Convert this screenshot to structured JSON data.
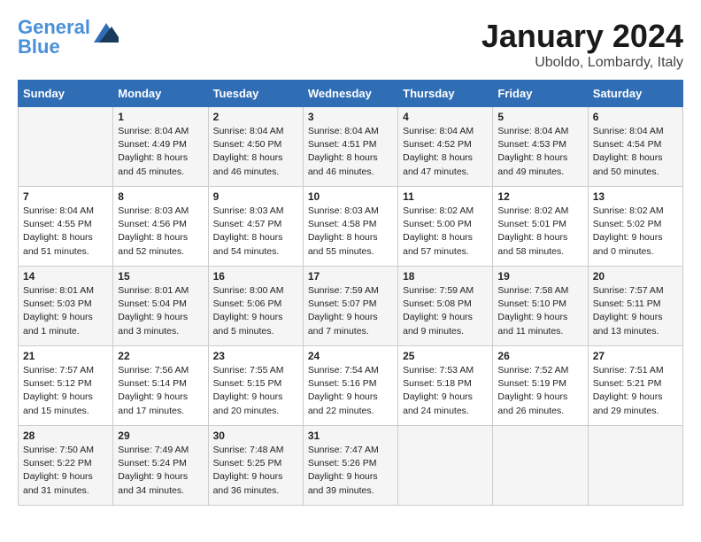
{
  "header": {
    "logo_line1": "General",
    "logo_line2": "Blue",
    "month": "January 2024",
    "location": "Uboldo, Lombardy, Italy"
  },
  "weekdays": [
    "Sunday",
    "Monday",
    "Tuesday",
    "Wednesday",
    "Thursday",
    "Friday",
    "Saturday"
  ],
  "weeks": [
    [
      {
        "day": "",
        "info": ""
      },
      {
        "day": "1",
        "info": "Sunrise: 8:04 AM\nSunset: 4:49 PM\nDaylight: 8 hours\nand 45 minutes."
      },
      {
        "day": "2",
        "info": "Sunrise: 8:04 AM\nSunset: 4:50 PM\nDaylight: 8 hours\nand 46 minutes."
      },
      {
        "day": "3",
        "info": "Sunrise: 8:04 AM\nSunset: 4:51 PM\nDaylight: 8 hours\nand 46 minutes."
      },
      {
        "day": "4",
        "info": "Sunrise: 8:04 AM\nSunset: 4:52 PM\nDaylight: 8 hours\nand 47 minutes."
      },
      {
        "day": "5",
        "info": "Sunrise: 8:04 AM\nSunset: 4:53 PM\nDaylight: 8 hours\nand 49 minutes."
      },
      {
        "day": "6",
        "info": "Sunrise: 8:04 AM\nSunset: 4:54 PM\nDaylight: 8 hours\nand 50 minutes."
      }
    ],
    [
      {
        "day": "7",
        "info": "Sunrise: 8:04 AM\nSunset: 4:55 PM\nDaylight: 8 hours\nand 51 minutes."
      },
      {
        "day": "8",
        "info": "Sunrise: 8:03 AM\nSunset: 4:56 PM\nDaylight: 8 hours\nand 52 minutes."
      },
      {
        "day": "9",
        "info": "Sunrise: 8:03 AM\nSunset: 4:57 PM\nDaylight: 8 hours\nand 54 minutes."
      },
      {
        "day": "10",
        "info": "Sunrise: 8:03 AM\nSunset: 4:58 PM\nDaylight: 8 hours\nand 55 minutes."
      },
      {
        "day": "11",
        "info": "Sunrise: 8:02 AM\nSunset: 5:00 PM\nDaylight: 8 hours\nand 57 minutes."
      },
      {
        "day": "12",
        "info": "Sunrise: 8:02 AM\nSunset: 5:01 PM\nDaylight: 8 hours\nand 58 minutes."
      },
      {
        "day": "13",
        "info": "Sunrise: 8:02 AM\nSunset: 5:02 PM\nDaylight: 9 hours\nand 0 minutes."
      }
    ],
    [
      {
        "day": "14",
        "info": "Sunrise: 8:01 AM\nSunset: 5:03 PM\nDaylight: 9 hours\nand 1 minute."
      },
      {
        "day": "15",
        "info": "Sunrise: 8:01 AM\nSunset: 5:04 PM\nDaylight: 9 hours\nand 3 minutes."
      },
      {
        "day": "16",
        "info": "Sunrise: 8:00 AM\nSunset: 5:06 PM\nDaylight: 9 hours\nand 5 minutes."
      },
      {
        "day": "17",
        "info": "Sunrise: 7:59 AM\nSunset: 5:07 PM\nDaylight: 9 hours\nand 7 minutes."
      },
      {
        "day": "18",
        "info": "Sunrise: 7:59 AM\nSunset: 5:08 PM\nDaylight: 9 hours\nand 9 minutes."
      },
      {
        "day": "19",
        "info": "Sunrise: 7:58 AM\nSunset: 5:10 PM\nDaylight: 9 hours\nand 11 minutes."
      },
      {
        "day": "20",
        "info": "Sunrise: 7:57 AM\nSunset: 5:11 PM\nDaylight: 9 hours\nand 13 minutes."
      }
    ],
    [
      {
        "day": "21",
        "info": "Sunrise: 7:57 AM\nSunset: 5:12 PM\nDaylight: 9 hours\nand 15 minutes."
      },
      {
        "day": "22",
        "info": "Sunrise: 7:56 AM\nSunset: 5:14 PM\nDaylight: 9 hours\nand 17 minutes."
      },
      {
        "day": "23",
        "info": "Sunrise: 7:55 AM\nSunset: 5:15 PM\nDaylight: 9 hours\nand 20 minutes."
      },
      {
        "day": "24",
        "info": "Sunrise: 7:54 AM\nSunset: 5:16 PM\nDaylight: 9 hours\nand 22 minutes."
      },
      {
        "day": "25",
        "info": "Sunrise: 7:53 AM\nSunset: 5:18 PM\nDaylight: 9 hours\nand 24 minutes."
      },
      {
        "day": "26",
        "info": "Sunrise: 7:52 AM\nSunset: 5:19 PM\nDaylight: 9 hours\nand 26 minutes."
      },
      {
        "day": "27",
        "info": "Sunrise: 7:51 AM\nSunset: 5:21 PM\nDaylight: 9 hours\nand 29 minutes."
      }
    ],
    [
      {
        "day": "28",
        "info": "Sunrise: 7:50 AM\nSunset: 5:22 PM\nDaylight: 9 hours\nand 31 minutes."
      },
      {
        "day": "29",
        "info": "Sunrise: 7:49 AM\nSunset: 5:24 PM\nDaylight: 9 hours\nand 34 minutes."
      },
      {
        "day": "30",
        "info": "Sunrise: 7:48 AM\nSunset: 5:25 PM\nDaylight: 9 hours\nand 36 minutes."
      },
      {
        "day": "31",
        "info": "Sunrise: 7:47 AM\nSunset: 5:26 PM\nDaylight: 9 hours\nand 39 minutes."
      },
      {
        "day": "",
        "info": ""
      },
      {
        "day": "",
        "info": ""
      },
      {
        "day": "",
        "info": ""
      }
    ]
  ]
}
